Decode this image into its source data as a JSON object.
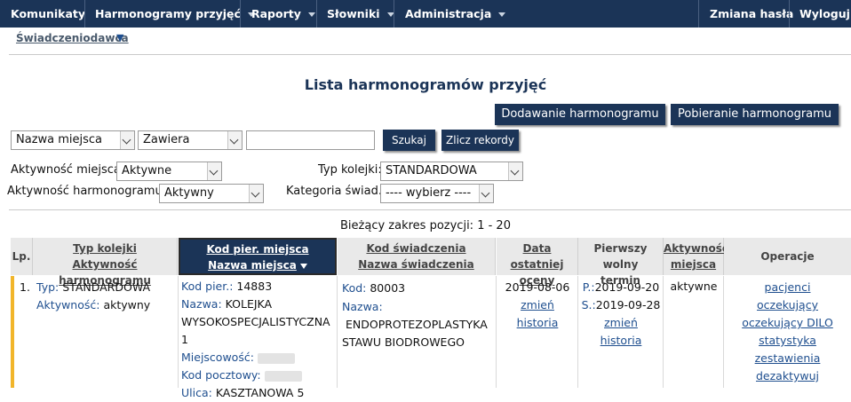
{
  "nav": {
    "items": [
      {
        "label": "Komunikaty",
        "dropdown": false
      },
      {
        "label": "Harmonogramy przyjęć",
        "dropdown": true
      },
      {
        "label": "Raporty",
        "dropdown": true
      },
      {
        "label": "Słowniki",
        "dropdown": true
      },
      {
        "label": "Administracja",
        "dropdown": true
      }
    ],
    "right": [
      {
        "label": "Zmiana hasła"
      },
      {
        "label": "Wyloguj"
      }
    ],
    "bg_color": "#1b3457"
  },
  "breadcrumb": {
    "label": "Świadczeniodawca"
  },
  "page_title": "Lista harmonogramów przyjęć",
  "actions": {
    "add_label": "Dodawanie harmonogramu",
    "download_label": "Pobieranie harmonogramu"
  },
  "search": {
    "field_value": "Nazwa miejsca",
    "operator_value": "Zawiera",
    "query_value": "",
    "search_label": "Szukaj",
    "count_label": "Zlicz rekordy"
  },
  "filters": {
    "place_activity_label": "Aktywność miejsca:",
    "place_activity_value": "Aktywne",
    "schedule_activity_label": "Aktywność harmonogramu:",
    "schedule_activity_value": "Aktywny",
    "queue_type_label": "Typ kolejki:",
    "queue_type_value": "STANDARDOWA",
    "category_label": "Kategoria świad.:",
    "category_value": "---- wybierz ----"
  },
  "range_text": "Bieżący zakres pozycji: 1 - 20",
  "table": {
    "headers": {
      "lp": "Lp.",
      "queue_type": "Typ kolejki",
      "schedule_activity": "Aktywność harmonogramu",
      "place_code": "Kod pier. miejsca",
      "place_name": "Nazwa miejsca",
      "service_code": "Kod świadczenia",
      "service_name": "Nazwa świadczenia",
      "last_eval_1": "Data ostatniej",
      "last_eval_2": "oceny",
      "first_free_1": "Pierwszy wolny",
      "first_free_2": "termin",
      "place_activity_1": "Aktywność",
      "place_activity_2": "miejsca",
      "operations": "Operacje"
    },
    "rows": [
      {
        "lp": "1.",
        "type_label": "Typ:",
        "type_value": "STANDARDOWA",
        "activity_label": "Aktywność:",
        "activity_value": "aktywny",
        "place_code_label": "Kod pier.:",
        "place_code_value": "14883",
        "place_name_label": "Nazwa:",
        "place_name_value_1": "KOLEJKA",
        "place_name_value_2": "WYSOKOSPECJALISTYCZNA 1",
        "city_label": "Miejscowość:",
        "postal_label": "Kod pocztowy:",
        "street_label": "Ulica:",
        "street_value": "KASZTANOWA 5",
        "service_code_label": "Kod:",
        "service_code_value": "80003",
        "service_name_label": "Nazwa:",
        "service_name_value_1": "ENDOPROTEZOPLASTYKA",
        "service_name_value_2": "STAWU BIODROWEGO",
        "last_eval_date": "2019-08-06",
        "change_label": "zmień",
        "history_label": "historia",
        "p_label": "P.:",
        "p_date": "2019-09-20",
        "s_label": "S.:",
        "s_date": "2019-09-28",
        "change2_label": "zmień",
        "history2_label": "historia",
        "place_activity": "aktywne",
        "ops": [
          "pacjenci",
          "oczekujący",
          "oczekujący DILO",
          "statystyka",
          "zestawienia",
          "dezaktywuj"
        ]
      }
    ]
  }
}
